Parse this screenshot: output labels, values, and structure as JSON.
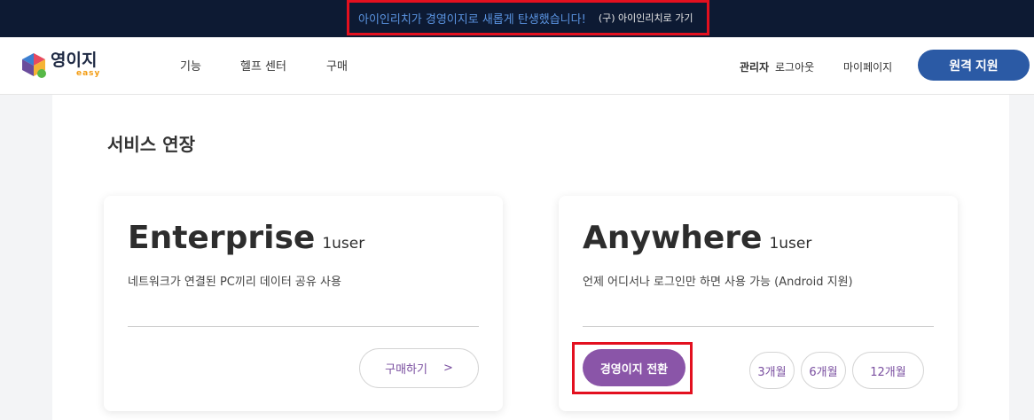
{
  "banner": {
    "notice": "아이인리치가 경영이지로 새롭게 탄생했습니다!",
    "old_link": "(구) 아이인리치로 가기"
  },
  "header": {
    "logo_text": "영이지",
    "logo_sub": "easy",
    "nav": [
      "기능",
      "헬프 센터",
      "구매"
    ],
    "admin_label": "관리자",
    "logout_label": "로그아웃",
    "mypage_label": "마이페이지",
    "remote_support_label": "원격 지원"
  },
  "main": {
    "section_title": "서비스 연장",
    "cards": [
      {
        "title": "Enterprise",
        "unit": "1user",
        "description": "네트워크가 연결된 PC끼리 데이터 공유 사용",
        "buy_label": "구매하기",
        "buy_arrow": ">"
      },
      {
        "title": "Anywhere",
        "unit": "1user",
        "description": "언제 어디서나 로그인만 하면 사용 가능 (Android 지원)",
        "convert_label": "경영이지 전환",
        "periods": [
          "3개월",
          "6개월",
          "12개월"
        ]
      }
    ]
  },
  "colors": {
    "topbar": "#0d1a33",
    "highlight": "#e3101f",
    "accent_blue": "#2b5aa5",
    "accent_purple": "#8a55a8"
  }
}
